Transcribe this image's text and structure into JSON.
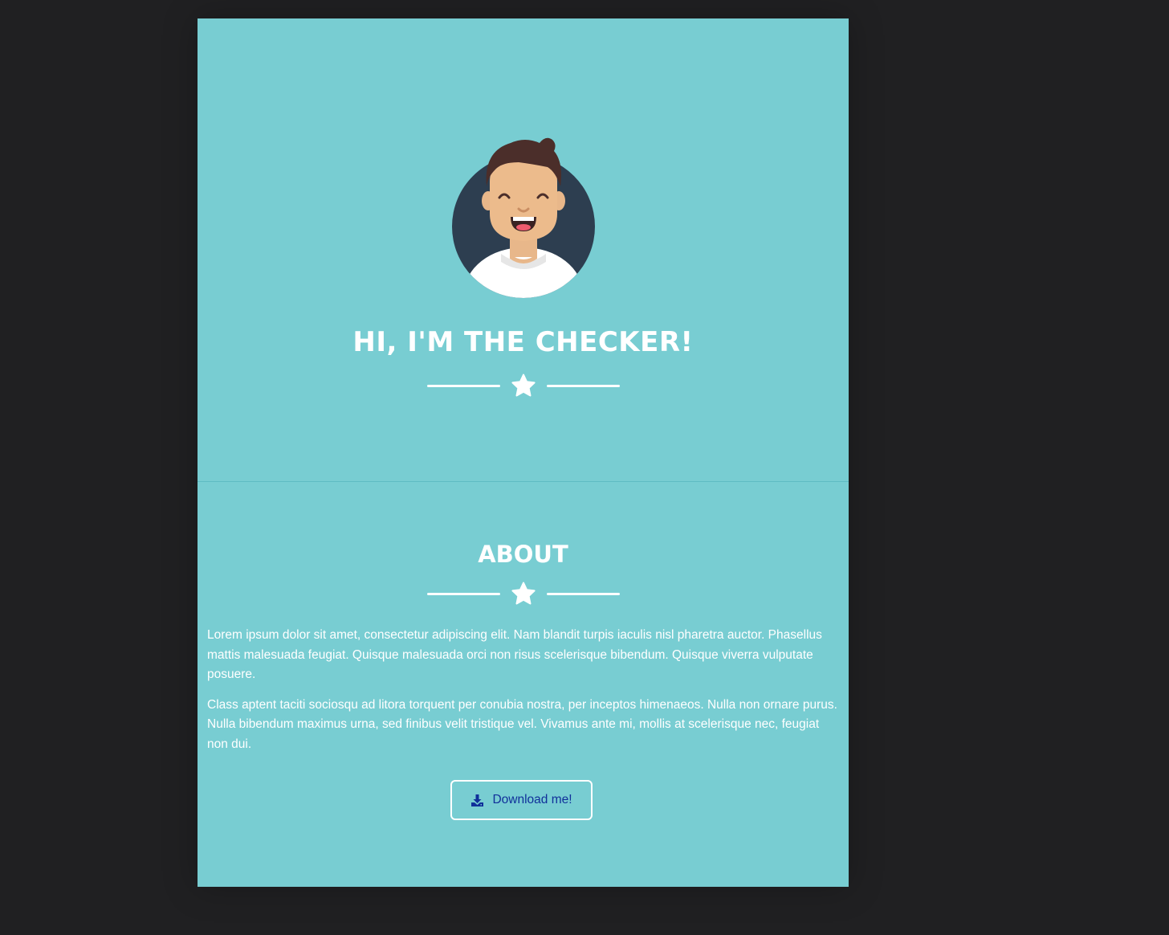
{
  "hero": {
    "title": "HI, I'M THE CHECKER!"
  },
  "about": {
    "title": "ABOUT",
    "paragraphs": [
      "Lorem ipsum dolor sit amet, consectetur adipiscing elit. Nam blandit turpis iaculis nisl pharetra auctor. Phasellus mattis malesuada feugiat. Quisque malesuada orci non risus scelerisque bibendum. Quisque viverra vulputate posuere.",
      "Class aptent taciti sociosqu ad litora torquent per conubia nostra, per inceptos himenaeos. Nulla non ornare purus. Nulla bibendum maximus urna, sed finibus velit tristique vel. Vivamus ante mi, mollis at scelerisque nec, feugiat non dui."
    ],
    "download_label": "Download me!"
  },
  "icons": {
    "divider": "star-icon",
    "download": "download-icon",
    "avatar": "avatar-illustration"
  },
  "colors": {
    "page_background": "#202022",
    "card_background": "#78cdd2",
    "text": "#ffffff",
    "button_text": "#10309a",
    "avatar_circle": "#2d3e50"
  }
}
